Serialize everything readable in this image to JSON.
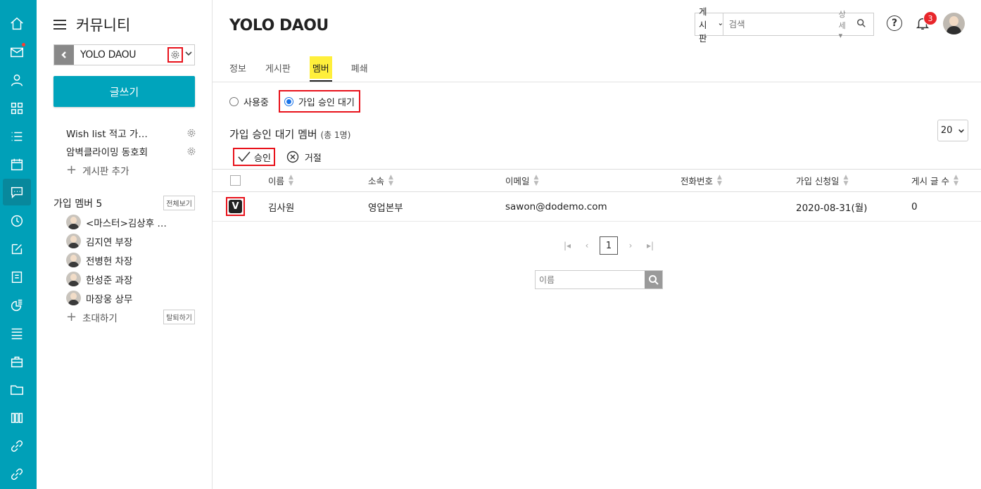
{
  "sidebar": {
    "title": "커뮤니티",
    "community_name": "YOLO DAOU",
    "write_button": "글쓰기",
    "boards": [
      "Wish list 적고 가…",
      "암벽클라이밍 동호회"
    ],
    "add_board": "게시판 추가",
    "members_title": "가입 멤버 5",
    "view_all": "전체보기",
    "members": [
      "<마스터>김상후 …",
      "김지연 부장",
      "전병헌 차장",
      "한성준 과장",
      "마장웅 상무"
    ],
    "invite": "초대하기",
    "leave": "탈퇴하기"
  },
  "header": {
    "title": "YOLO DAOU",
    "search_type": "게시판",
    "search_placeholder": "검색",
    "search_detail": "상세",
    "notification_count": "3"
  },
  "tabs": [
    "정보",
    "게시판",
    "멤버",
    "폐쇄"
  ],
  "active_tab": "멤버",
  "filters": {
    "in_use": "사용중",
    "pending": "가입 승인 대기",
    "selected": "가입 승인 대기"
  },
  "section": {
    "title": "가입 승인 대기 멤버",
    "count": "(총 1명)",
    "page_size": "20"
  },
  "actions": {
    "approve": "승인",
    "reject": "거절"
  },
  "table": {
    "columns": [
      "이름",
      "소속",
      "이메일",
      "전화번호",
      "가입 신청일",
      "게시 글 수"
    ],
    "rows": [
      {
        "name": "김사원",
        "dept": "영업본부",
        "email": "sawon@dodemo.com",
        "phone": "",
        "date": "2020-08-31(월)",
        "posts": "0",
        "checked": "V"
      }
    ]
  },
  "pagination": {
    "current": "1"
  },
  "bottom_search": {
    "placeholder": "이름"
  },
  "colors": {
    "rail": "#00a0b8",
    "accent": "#00a4bc",
    "highlight": "#ffef3b",
    "annotation": "#e8121b"
  }
}
